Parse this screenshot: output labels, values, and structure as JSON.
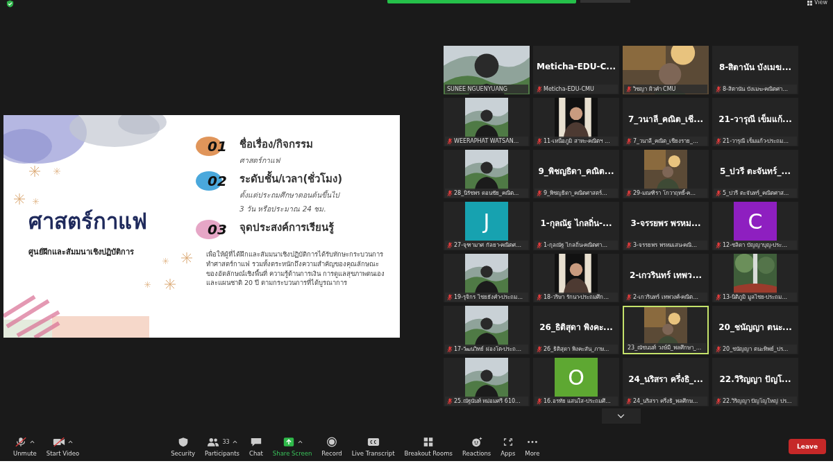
{
  "top_bar": {
    "view_label": "View"
  },
  "slide": {
    "title": "ศาสตร์กาแฟ",
    "subtitle": "ศูนย์ฝึกและสัมมนาเชิงปฏิบัติการ",
    "items": [
      {
        "number": "01",
        "color": "#e0955a",
        "heading": "ชื่อเรื่อง/กิจกรรม",
        "lines": [
          "ศาสตร์กาแฟ"
        ]
      },
      {
        "number": "02",
        "color": "#4aa8dc",
        "heading": "ระดับชั้น/เวลา(ชั่วโมง)",
        "lines": [
          "ตั้งแต่ประถมศึกษาตอนต้นขึ้นไป",
          "3 วัน หรือประมาณ 24 ชม."
        ]
      },
      {
        "number": "03",
        "color": "#e6a6c6",
        "heading": "จุดประสงค์การเรียนรู้"
      }
    ],
    "body": "เพื่อให้ผู้ที่ได้ฝึกและสัมมนาเชิงปฏิบัติการได้รับทักษะกระบวนการทำศาสตร์กาแฟ รวมทั้งตระหนักถึงความสำคัญของคุณลักษณะ ของอัตลักษณ์เชิงพื้นที่ ความรู้ด้านการเงิน การดูแลสุขภาพตนเอง และแผนชาติ 20 ปี ตามกระบวนการที่ได้บูรณาการ"
  },
  "gallery": {
    "tiles": [
      {
        "kind": "video",
        "label": "SUNEE NGUENYUANG",
        "muted": false,
        "active_speaker": false
      },
      {
        "kind": "name",
        "title": "Meticha-EDU-C...",
        "label": "Meticha-EDU-CMU",
        "muted": true,
        "active_speaker": false
      },
      {
        "kind": "video",
        "label": "วิชญา ผิวคำ CMU",
        "muted": true,
        "active_speaker": false
      },
      {
        "kind": "name",
        "title": "8-สิตานัน บังเมฆ...",
        "label": "8-สิตานัน บังเมฆ-คณิตศา...",
        "muted": true,
        "active_speaker": false
      },
      {
        "kind": "snapshot",
        "label": "WEERAPHAT WATSAN...",
        "muted": true,
        "active_speaker": false
      },
      {
        "kind": "snapshot",
        "label": "11-เหนือภูมิ สาหะ-คณิตฯ ...",
        "muted": true,
        "active_speaker": false
      },
      {
        "kind": "name",
        "title": "7_วนาลี_คณิต_เชี...",
        "label": "7_วนาลี_คณิต_เชียงราย_...",
        "muted": true,
        "active_speaker": false
      },
      {
        "kind": "name",
        "title": "21-วารุณี เข็มแก้...",
        "label": "21-วารุณี เข็มแก้ว-ประถม...",
        "muted": true,
        "active_speaker": false
      },
      {
        "kind": "snapshot",
        "label": "28_นิรัชพร ดอนชัย_คณิต...",
        "muted": true,
        "active_speaker": false
      },
      {
        "kind": "name",
        "title": "9_พิชญธิดา_คณิต...",
        "label": "9_พิชญธิดา_คณิตศาสตร์...",
        "muted": true,
        "active_speaker": false
      },
      {
        "kind": "snapshot",
        "label": "29-มณฑิรา โกวาฤทธิ์-ค...",
        "muted": true,
        "active_speaker": false
      },
      {
        "kind": "name",
        "title": "5_ปวรี ตะจันทร์_...",
        "label": "5_ปวรี ตะจันทร์_คณิตศาส...",
        "muted": true,
        "active_speaker": false
      },
      {
        "kind": "avatar",
        "letter": "J",
        "color": "#17a2b0",
        "label": "27-จุฑามาศ กัลยา-คณิตศ...",
        "muted": true,
        "active_speaker": false
      },
      {
        "kind": "name",
        "title": "1-กุลณัฐ ไกลถิ่น-...",
        "label": "1-กุลณัฐ ไกลถิ่น-คณิตศา...",
        "muted": true,
        "active_speaker": false
      },
      {
        "kind": "name",
        "title": "3-จรรยพร พรหม...",
        "label": "3-จรรยพร พรหมเสน-คณิ...",
        "muted": true,
        "active_speaker": false
      },
      {
        "kind": "avatar",
        "letter": "C",
        "color": "#8e1fc0",
        "label": "12-ชลิดา บัญญาบุญ-ประ...",
        "muted": true,
        "active_speaker": false
      },
      {
        "kind": "snapshot",
        "label": "19-รุจิกร ไชยยังคำ-ประถม...",
        "muted": true,
        "active_speaker": false
      },
      {
        "kind": "snapshot",
        "label": "18-วริษา รักนา-ประถมศึก...",
        "muted": true,
        "active_speaker": false
      },
      {
        "kind": "name",
        "title": "2-เกวรินทร์ เทพว...",
        "label": "2-เกวรินทร์ เทพวงศ์-คณิต...",
        "muted": true,
        "active_speaker": false
      },
      {
        "kind": "snapshot",
        "label": "13-นิติภูมิ มูลไชย-ประถม...",
        "muted": true,
        "active_speaker": false
      },
      {
        "kind": "snapshot",
        "label": "17-วัฒนวิทย์ ผ่องโต-ประถ...",
        "muted": true,
        "active_speaker": false
      },
      {
        "kind": "name",
        "title": "26_ธิติสุดา พิงคะ...",
        "label": "26_ธิติสุดา พิงคะสัน_ภาษ...",
        "muted": true,
        "active_speaker": false
      },
      {
        "kind": "snapshot",
        "label": "23_ณัชนนท์ วงษ์มี_พลศึกษา_...",
        "muted": false,
        "active_speaker": true
      },
      {
        "kind": "name",
        "title": "20_ชนัญญา ตนะ...",
        "label": "20_ชนัญญา ตนะทิพย์_ปร...",
        "muted": true,
        "active_speaker": false
      },
      {
        "kind": "snapshot",
        "label": "25.ณัฐนันท์ หม่อมศรี 610...",
        "muted": true,
        "active_speaker": false
      },
      {
        "kind": "avatar",
        "letter": "O",
        "color": "#5ea832",
        "label": "16.อรทัย แสนใส-ประถมศึ...",
        "muted": true,
        "active_speaker": false
      },
      {
        "kind": "name",
        "title": "24_นริสรา ครึ่งธิ_...",
        "label": "24_นริสรา ครึ่งธิ_พลศึกษ...",
        "muted": true,
        "active_speaker": false
      },
      {
        "kind": "name",
        "title": "22.วิริญญา ปัญโ...",
        "label": "22.วิริญญา ปัญโญใหญ่ ปร...",
        "muted": true,
        "active_speaker": false
      }
    ]
  },
  "toolbar": {
    "items": [
      {
        "label": "Unmute",
        "off": true,
        "menu": true
      },
      {
        "label": "Start Video",
        "off": true,
        "menu": true
      },
      {
        "label": "Security"
      },
      {
        "label": "Participants",
        "count": "33",
        "menu": true
      },
      {
        "label": "Chat"
      },
      {
        "label": "Share Screen",
        "menu": true,
        "accent": true
      },
      {
        "label": "Record"
      },
      {
        "label": "Live Transcript"
      },
      {
        "label": "Breakout Rooms"
      },
      {
        "label": "Reactions"
      },
      {
        "label": "Apps"
      },
      {
        "label": "More"
      }
    ],
    "leave": "Leave"
  }
}
